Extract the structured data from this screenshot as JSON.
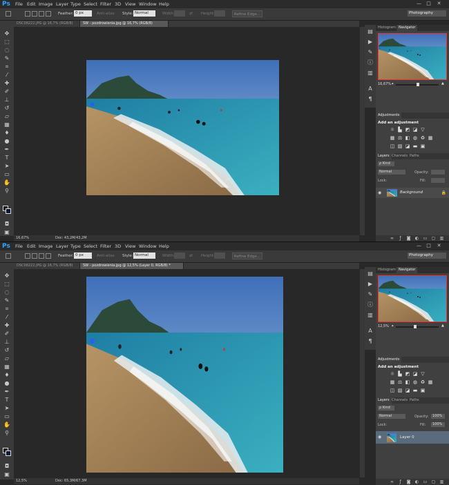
{
  "app": {
    "logo": "Ps"
  },
  "menu": [
    "File",
    "Edit",
    "Image",
    "Layer",
    "Type",
    "Select",
    "Filter",
    "3D",
    "View",
    "Window",
    "Help"
  ],
  "window_controls": [
    "—",
    "□",
    "✕"
  ],
  "options": {
    "feather_label": "Feather:",
    "feather_value": "0 px",
    "antialias_label": "Anti-alias",
    "style_label": "Style:",
    "style_value": "Normal",
    "width_label": "Width:",
    "height_label": "Height:",
    "refine_button": "Refine Edge...",
    "workspace": "Photography"
  },
  "icons": {
    "marquee": "marquee-icon",
    "eye": "eye-icon",
    "lock": "lock-icon"
  },
  "windows": [
    {
      "tabs": [
        {
          "label": "DSC08222.JPG @ 16,7% (RGB/8)"
        },
        {
          "label": "SW - pozdrowienia.jpg @ 16,7% (RGB/8)"
        }
      ],
      "status": {
        "zoom": "16,67%",
        "doc": "Doc: 43,2M/43,2M"
      },
      "panel_tabs": [
        "Histogram",
        "Navigator"
      ],
      "nav_zoom": "16,67%",
      "adjustments_tab": "Adjustments",
      "adjustments_title": "Add an adjustment",
      "layers_tabs": [
        "Layers",
        "Channels",
        "Paths"
      ],
      "kind_label": "ρ Kind",
      "blend_mode": "Normal",
      "opacity_label": "Opacity:",
      "opacity_value": "",
      "lock_label": "Lock:",
      "fill_label": "Fill:",
      "fill_value": "",
      "layer_name": "Background",
      "layer_selected": false
    },
    {
      "tabs": [
        {
          "label": "DSC08222.JPG @ 16,7% (RGB/8)"
        },
        {
          "label": "SW - pozdrowienia.jpg @ 12,5% (Layer 0, RGB/8) *"
        }
      ],
      "status": {
        "zoom": "12,5%",
        "doc": "Doc: 65,3M/67,3M"
      },
      "panel_tabs": [
        "Histogram",
        "Navigator"
      ],
      "nav_zoom": "12,5%",
      "adjustments_tab": "Adjustments",
      "adjustments_title": "Add an adjustment",
      "layers_tabs": [
        "Layers",
        "Channels",
        "Paths"
      ],
      "kind_label": "ρ Kind",
      "blend_mode": "Normal",
      "opacity_label": "Opacity:",
      "opacity_value": "100%",
      "lock_label": "Lock:",
      "fill_label": "Fill:",
      "fill_value": "100%",
      "layer_name": "Layer 0",
      "layer_selected": true
    }
  ]
}
